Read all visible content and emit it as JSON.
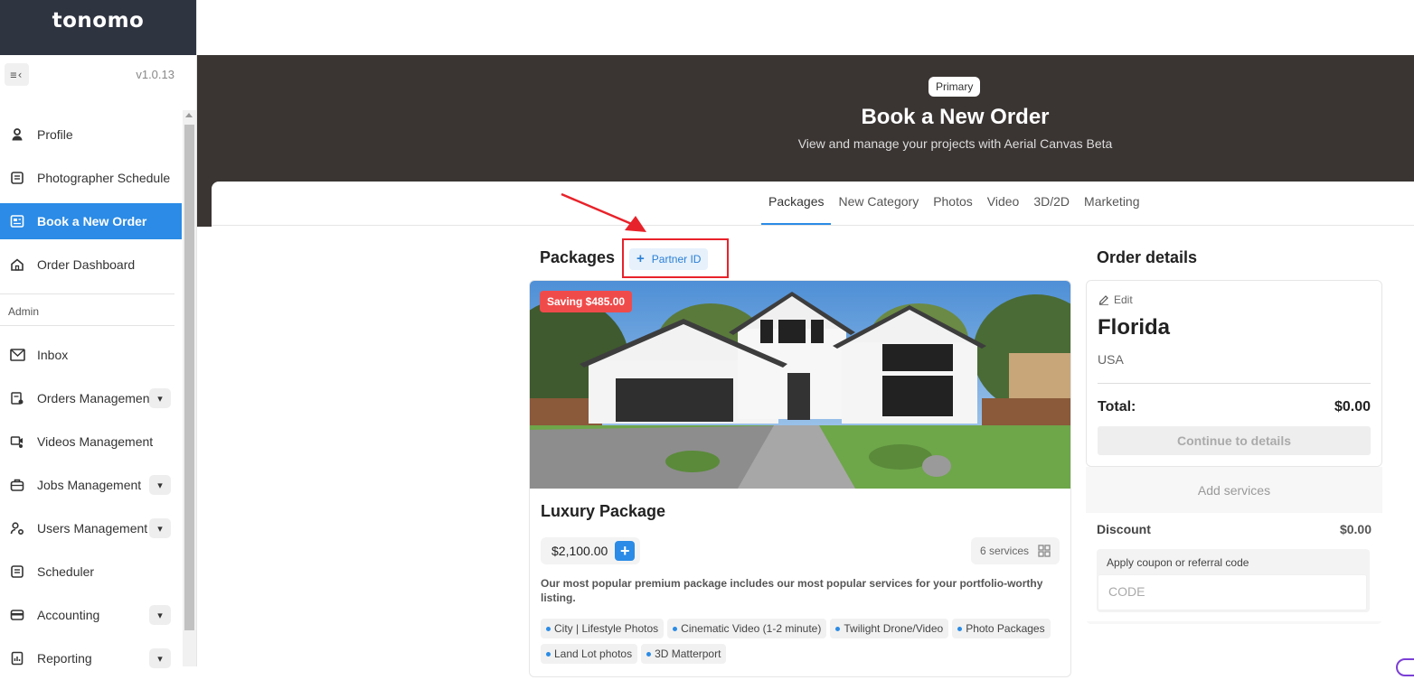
{
  "brand": "tonomo",
  "version": "v1.0.13",
  "sidebar": {
    "items": [
      {
        "label": "Profile"
      },
      {
        "label": "Photographer Schedule"
      },
      {
        "label": "Book a New Order"
      },
      {
        "label": "Order Dashboard"
      }
    ],
    "admin_label": "Admin",
    "admin_items": [
      {
        "label": "Inbox"
      },
      {
        "label": "Orders Management"
      },
      {
        "label": "Videos Management"
      },
      {
        "label": "Jobs Management"
      },
      {
        "label": "Users Management"
      },
      {
        "label": "Scheduler"
      },
      {
        "label": "Accounting"
      },
      {
        "label": "Reporting"
      }
    ]
  },
  "header": {
    "pill": "Primary",
    "title": "Book a New Order",
    "subtitle": "View and manage your projects with Aerial Canvas Beta"
  },
  "tabs": [
    "Packages",
    "New Category",
    "Photos",
    "Video",
    "3D/2D",
    "Marketing"
  ],
  "packages": {
    "heading": "Packages",
    "partner_btn": "Partner ID",
    "card": {
      "saving": "Saving $485.00",
      "name": "Luxury Package",
      "price": "$2,100.00",
      "services": "6 services",
      "description": "Our most popular premium package includes our most popular services for your portfolio-worthy listing.",
      "tags": [
        "City | Lifestyle Photos",
        "Cinematic Video (1-2 minute)",
        "Twilight Drone/Video",
        "Photo Packages",
        "Land Lot photos",
        "3D Matterport"
      ]
    }
  },
  "order": {
    "title": "Order details",
    "edit": "Edit",
    "state": "Florida",
    "country": "USA",
    "total_label": "Total:",
    "total_value": "$0.00",
    "continue": "Continue to details",
    "add_services": "Add services",
    "discount_label": "Discount",
    "discount_value": "$0.00",
    "coupon_label": "Apply coupon or referral code",
    "coupon_placeholder": "CODE"
  },
  "colors": {
    "accent": "#2b8be6",
    "header_bg": "#3a3533",
    "brand_bg": "#2f3441",
    "highlight": "#e8222a"
  }
}
